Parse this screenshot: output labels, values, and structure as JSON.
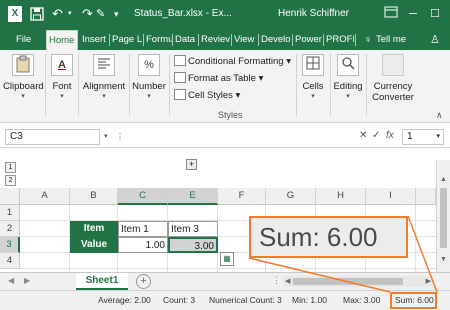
{
  "titlebar": {
    "logo": "X",
    "save_icon": "save-icon",
    "undo_icon": "undo-icon",
    "redo_icon": "redo-icon",
    "brush_icon": "format-painter-icon",
    "more_icon": "customize-toolbar-icon",
    "document_title": "Status_Bar.xlsx - Ex...",
    "user_name": "Henrik Schiffner"
  },
  "tabs": [
    {
      "label": "File"
    },
    {
      "label": "Home"
    },
    {
      "label": "Insert"
    },
    {
      "label": "Page L"
    },
    {
      "label": "Formu"
    },
    {
      "label": "Data"
    },
    {
      "label": "Reviev"
    },
    {
      "label": "View"
    },
    {
      "label": "Develo"
    },
    {
      "label": "Power"
    },
    {
      "label": "PROFI"
    },
    {
      "label": "Tell me"
    }
  ],
  "ribbon": {
    "clipboard": "Clipboard",
    "font": "Font",
    "alignment": "Alignment",
    "number": "Number",
    "conditional_formatting": "Conditional Formatting",
    "format_as_table": "Format as Table",
    "cell_styles": "Cell Styles",
    "styles_group": "Styles",
    "cells": "Cells",
    "editing": "Editing",
    "currency_converter": "Currency Converter",
    "number_icon": "%",
    "font_icon": "A"
  },
  "formula_bar": {
    "name_box": "C3",
    "cancel": "✕",
    "enter": "✓",
    "fx": "fx",
    "zoom_value": "1"
  },
  "outline": {
    "plus": "+",
    "levels": [
      "1",
      "2"
    ]
  },
  "grid": {
    "columns": [
      "A",
      "B",
      "C",
      "E",
      "F",
      "G",
      "H",
      "I"
    ],
    "rows": [
      "1",
      "2",
      "3",
      "4"
    ],
    "cells": {
      "b2": "Item",
      "c2": "Item 1",
      "e2": "Item 3",
      "b3": "Value",
      "c3": "1.00",
      "e3": "3.00"
    }
  },
  "sheets": {
    "active": "Sheet1",
    "add": "+"
  },
  "status_bar": {
    "average": "Average: 2.00",
    "count": "Count: 3",
    "numerical_count": "Numerical Count: 3",
    "min": "Min: 1.00",
    "max": "Max: 3.00",
    "sum": "Sum: 6.00"
  },
  "callout": {
    "text": "Sum: 6.00",
    "color": "#ed7d31"
  },
  "colors": {
    "excel_green": "#217346",
    "highlight": "#ed7d31"
  }
}
